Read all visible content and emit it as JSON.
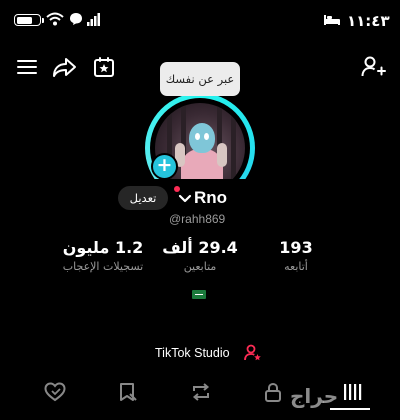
{
  "status_bar": {
    "time": "١١:٤٣",
    "battery_level": 0.75
  },
  "tooltip": {
    "text": "عبر عن نفسك"
  },
  "profile": {
    "edit_label": "تعديل",
    "display_name": "Rno",
    "username": "@rahh869"
  },
  "stats": {
    "likes": {
      "value": "1.2 مليون",
      "label": "تسجيلات الإعجاب"
    },
    "followers": {
      "value": "29.4 ألف",
      "label": "متابعين"
    },
    "following": {
      "value": "193",
      "label": "أتابعه"
    }
  },
  "studio": {
    "label": "TikTok Studio"
  },
  "tabs": [
    {
      "icon": "liked-heart-icon"
    },
    {
      "icon": "favorites-icon"
    },
    {
      "icon": "repost-icon"
    },
    {
      "icon": "lock-icon"
    },
    {
      "icon": "videos-grid-icon",
      "active": true
    }
  ],
  "watermark": {
    "text": "حراج"
  },
  "colors": {
    "accent": "#25f4ee",
    "badge": "#fe2c55",
    "background": "#000000"
  }
}
